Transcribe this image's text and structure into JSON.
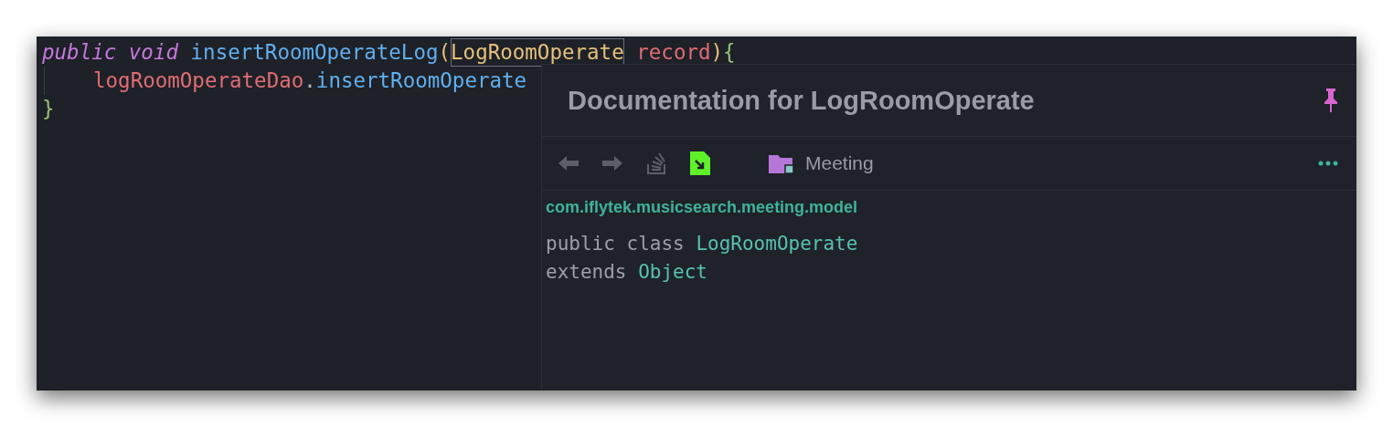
{
  "editor": {
    "lines": [
      {
        "indent": false,
        "tokens": [
          {
            "text": "public void ",
            "kind": "keyword"
          },
          {
            "text": "insertRoomOperateLog",
            "kind": "function"
          },
          {
            "text": "(",
            "kind": "paren"
          },
          {
            "text": "LogRoomOperate",
            "kind": "type",
            "highlighted": true
          },
          {
            "text": " record",
            "kind": "param"
          },
          {
            "text": ")",
            "kind": "paren"
          },
          {
            "text": "{",
            "kind": "brace"
          }
        ]
      },
      {
        "indent": true,
        "tokens": [
          {
            "text": "logRoomOperateDao",
            "kind": "field"
          },
          {
            "text": ".",
            "kind": "punct"
          },
          {
            "text": "insertRoomOperate",
            "kind": "function"
          }
        ]
      },
      {
        "indent": false,
        "tokens": [
          {
            "text": "}",
            "kind": "brace"
          }
        ]
      }
    ]
  },
  "documentation": {
    "title": "Documentation for LogRoomOperate",
    "pinned": true,
    "toolbar": {
      "module": "Meeting"
    },
    "package": "com.iflytek.musicsearch.meeting.model",
    "signature": [
      [
        {
          "text": "public class ",
          "kind": "plain"
        },
        {
          "text": "LogRoomOperate",
          "kind": "link"
        }
      ],
      [
        {
          "text": "extends ",
          "kind": "plain"
        },
        {
          "text": "Object",
          "kind": "link"
        }
      ]
    ]
  }
}
